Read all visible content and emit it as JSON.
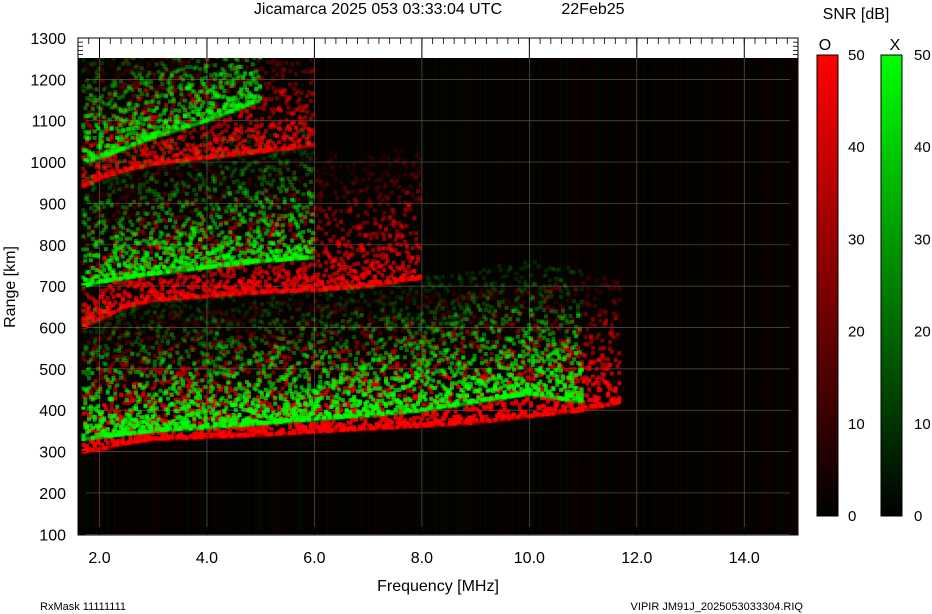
{
  "chart_data": {
    "type": "heatmap",
    "title": "Jicamarca 2025 053 03:33:04 UTC",
    "date_label": "22Feb25",
    "xlabel": "Frequency [MHz]",
    "ylabel": "Range [km]",
    "xlim": [
      1.6,
      15.0
    ],
    "ylim": [
      50,
      1300
    ],
    "x_ticks": [
      2.0,
      4.0,
      6.0,
      8.0,
      10.0,
      12.0,
      14.0
    ],
    "x_tick_labels": [
      "2.0",
      "4.0",
      "6.0",
      "8.0",
      "10.0",
      "12.0",
      "14.0"
    ],
    "y_ticks": [
      100,
      200,
      300,
      400,
      500,
      600,
      700,
      800,
      900,
      1000,
      1100,
      1200,
      1300
    ],
    "y_tick_labels": [
      "100",
      "200",
      "300",
      "400",
      "500",
      "600",
      "700",
      "800",
      "900",
      "1000",
      "1100",
      "1200",
      "1300"
    ],
    "grid": true,
    "colorbar": {
      "title": "SNR [dB]",
      "range": [
        0,
        50
      ],
      "ticks": [
        0,
        10,
        20,
        30,
        40,
        50
      ],
      "tick_labels": [
        "0",
        "10",
        "20",
        "30",
        "40",
        "50"
      ],
      "o_label": "O",
      "x_label": "X",
      "o_color": "#ff0000",
      "x_color": "#00ff00"
    },
    "series": [
      {
        "name": "O",
        "color": "#ff0000",
        "traces": [
          {
            "points": [
              [
                1.7,
                300
              ],
              [
                2.0,
                305
              ],
              [
                2.5,
                320
              ],
              [
                3.0,
                330
              ],
              [
                4.0,
                335
              ],
              [
                5.0,
                340
              ],
              [
                6.0,
                348
              ],
              [
                7.0,
                355
              ],
              [
                8.0,
                362
              ],
              [
                9.0,
                370
              ],
              [
                10.0,
                385
              ],
              [
                11.0,
                400
              ],
              [
                11.7,
                420
              ]
            ],
            "snr": 48
          },
          {
            "points": [
              [
                1.7,
                600
              ],
              [
                2.0,
                620
              ],
              [
                2.5,
                650
              ],
              [
                3.0,
                665
              ],
              [
                4.0,
                675
              ],
              [
                5.0,
                685
              ],
              [
                6.0,
                690
              ],
              [
                7.0,
                700
              ],
              [
                8.0,
                720
              ]
            ],
            "snr": 40
          },
          {
            "points": [
              [
                1.7,
                940
              ],
              [
                2.0,
                960
              ],
              [
                2.5,
                980
              ],
              [
                3.0,
                995
              ],
              [
                4.0,
                1010
              ],
              [
                5.0,
                1025
              ],
              [
                6.0,
                1040
              ]
            ],
            "snr": 36
          }
        ]
      },
      {
        "name": "X",
        "color": "#00ff00",
        "traces": [
          {
            "points": [
              [
                1.7,
                330
              ],
              [
                2.0,
                335
              ],
              [
                3.0,
                350
              ],
              [
                4.0,
                358
              ],
              [
                5.0,
                368
              ],
              [
                6.0,
                378
              ],
              [
                7.0,
                388
              ],
              [
                8.0,
                400
              ],
              [
                9.0,
                420
              ],
              [
                10.0,
                440
              ],
              [
                11.0,
                420
              ]
            ],
            "snr": 45
          },
          {
            "points": [
              [
                1.7,
                700
              ],
              [
                2.0,
                710
              ],
              [
                3.0,
                730
              ],
              [
                4.0,
                745
              ],
              [
                5.0,
                760
              ],
              [
                6.0,
                770
              ]
            ],
            "snr": 38
          },
          {
            "points": [
              [
                1.7,
                1000
              ],
              [
                2.0,
                1010
              ],
              [
                3.0,
                1060
              ],
              [
                4.0,
                1100
              ],
              [
                5.0,
                1150
              ]
            ],
            "snr": 34
          }
        ]
      }
    ]
  },
  "footer": {
    "rx_mask": "RxMask 11111111",
    "file_info": "VIPIR  JM91J_2025053033304.RIQ"
  }
}
